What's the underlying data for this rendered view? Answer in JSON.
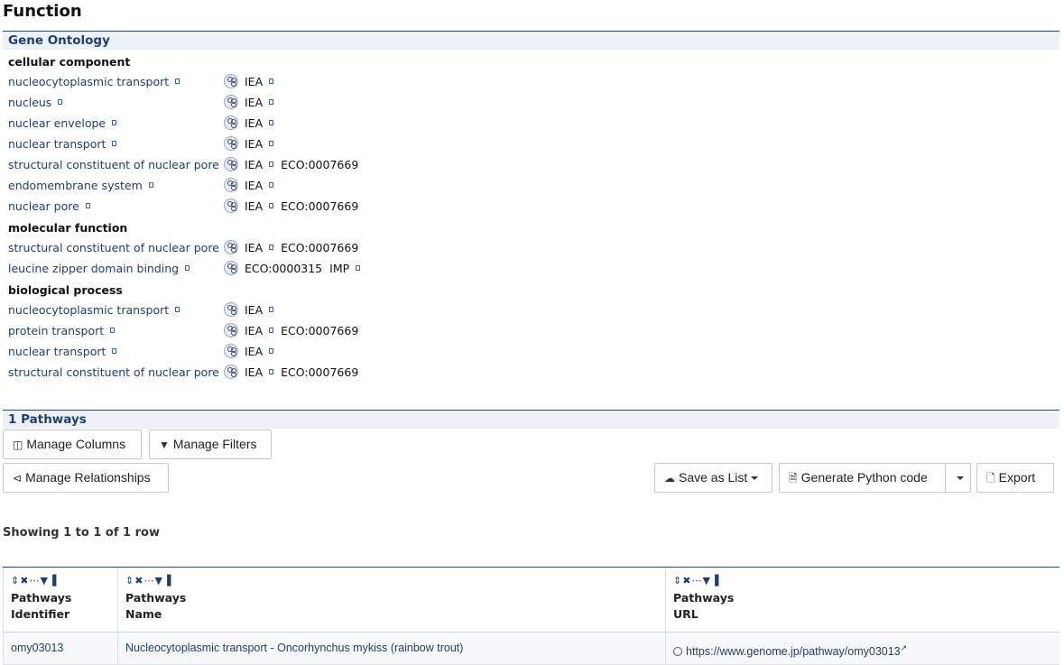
{
  "page": {
    "title": "Function"
  },
  "gene_ontology": {
    "header": "Gene Ontology",
    "groups": [
      {
        "name": "cellular component",
        "terms": [
          {
            "term": "nucleocytoplasmic transport",
            "evidence": "IEA",
            "eco": ""
          },
          {
            "term": "nucleus",
            "evidence": "IEA",
            "eco": ""
          },
          {
            "term": "nuclear envelope",
            "evidence": "IEA",
            "eco": ""
          },
          {
            "term": "nuclear transport",
            "evidence": "IEA",
            "eco": ""
          },
          {
            "term": "structural constituent of nuclear pore",
            "evidence": "IEA",
            "eco": "ECO:0007669"
          },
          {
            "term": "endomembrane system",
            "evidence": "IEA",
            "eco": ""
          },
          {
            "term": "nuclear pore",
            "evidence": "IEA",
            "eco": "ECO:0007669"
          }
        ]
      },
      {
        "name": "molecular function",
        "terms": [
          {
            "term": "structural constituent of nuclear pore",
            "evidence": "IEA",
            "eco": "ECO:0007669"
          },
          {
            "term": "leucine zipper domain binding",
            "evidence": "ECO:0000315",
            "eco": "IMP"
          }
        ]
      },
      {
        "name": "biological process",
        "terms": [
          {
            "term": "nucleocytoplasmic transport",
            "evidence": "IEA",
            "eco": ""
          },
          {
            "term": "protein transport",
            "evidence": "IEA",
            "eco": "ECO:0007669"
          },
          {
            "term": "nuclear transport",
            "evidence": "IEA",
            "eco": ""
          },
          {
            "term": "structural constituent of nuclear pore",
            "evidence": "IEA",
            "eco": "ECO:0007669"
          }
        ]
      }
    ]
  },
  "pathways": {
    "header": "1 Pathways",
    "toolbar": {
      "manage_columns": "Manage Columns",
      "manage_filters": "Manage Filters",
      "manage_relationships": "Manage Relationships",
      "save_as_list": "Save as List",
      "generate_python": "Generate Python code",
      "export": "Export"
    },
    "row_count": "Showing 1 to 1 of 1 row",
    "columns": [
      {
        "line1": "Pathways",
        "line2": "Identifier"
      },
      {
        "line1": "Pathways",
        "line2": "Name"
      },
      {
        "line1": "Pathways",
        "line2": "URL"
      }
    ],
    "rows": [
      {
        "identifier": "omy03013",
        "name": "Nucleocytoplasmic transport - Oncorhynchus mykiss (rainbow trout)",
        "url": "https://www.genome.jp/pathway/omy03013"
      }
    ]
  },
  "icons": {
    "column_tools": [
      "sort-icon",
      "remove-icon",
      "summary-icon",
      "filter-icon",
      "chart-icon"
    ],
    "colors": {
      "link": "#1f3f73",
      "header_bg": "#eef1f6",
      "rule": "#2f4a7a"
    }
  }
}
